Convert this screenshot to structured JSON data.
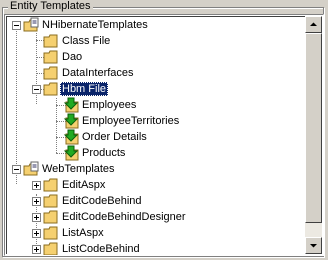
{
  "groupbox": {
    "title": "Entity Templates"
  },
  "tree": {
    "root1": {
      "label": "NHibernateTemplates",
      "children": [
        "Class File",
        "Dao",
        "DataInterfaces"
      ],
      "hbm": {
        "label": "Hbm File",
        "children": [
          "Employees",
          "EmployeeTerritories",
          "Order Details",
          "Products"
        ]
      }
    },
    "root2": {
      "label": "WebTemplates",
      "children": [
        "EditAspx",
        "EditCodeBehind",
        "EditCodeBehindDesigner",
        "ListAspx",
        "ListCodeBehind"
      ]
    }
  },
  "icons": {
    "root": "folder-with-document-icon",
    "folder": "folder-icon",
    "entity": "green-arrow-document-icon"
  },
  "colors": {
    "selection": "#0a246a",
    "folder": "#f5d070",
    "arrow": "#22aa22"
  }
}
